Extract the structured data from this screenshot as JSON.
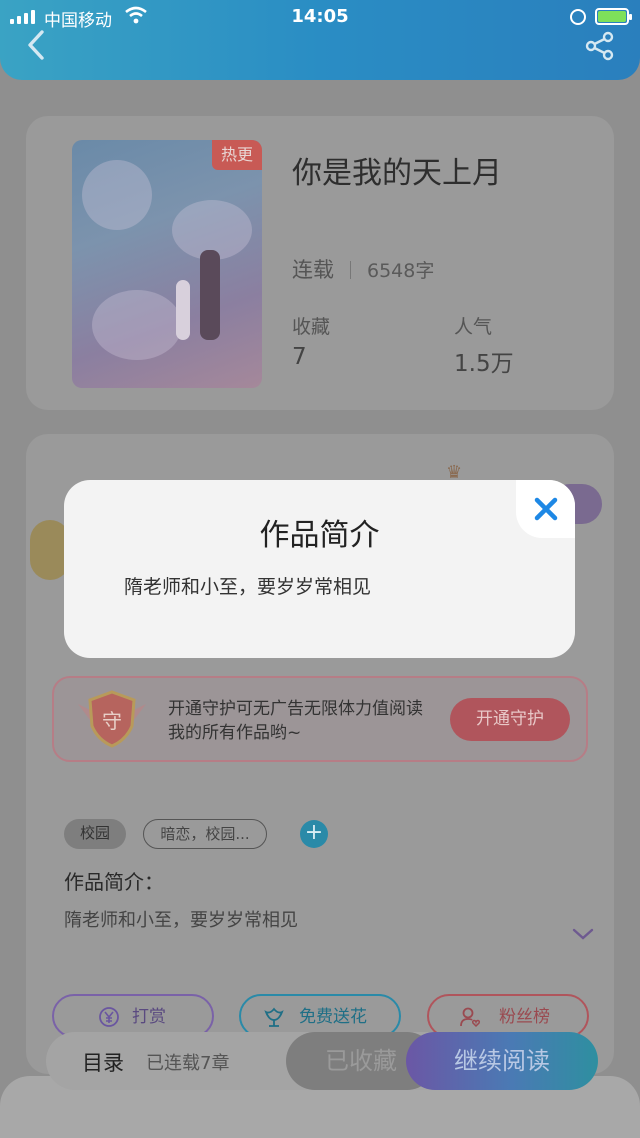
{
  "status_bar": {
    "carrier": "中国移动",
    "time": "14:05"
  },
  "book": {
    "tag": "热更",
    "title": "你是我的天上月",
    "status": "连载",
    "words": "6548字",
    "favorites_label": "收藏",
    "favorites": "7",
    "popularity_label": "人气",
    "popularity": "1.5万"
  },
  "guard": {
    "shield_char": "守",
    "text": "开通守护可无广告无限体力值阅读我的所有作品哟~",
    "button": "开通守护"
  },
  "tags": [
    "校园",
    "暗恋，校园..."
  ],
  "intro": {
    "heading": "作品简介：",
    "text": "隋老师和小至，要岁岁常相见"
  },
  "actions": {
    "reward": "打赏",
    "flower": "免费送花",
    "fans": "粉丝榜"
  },
  "bottom_bar": {
    "directory": "目录",
    "chapters": "已连载7章",
    "favorited": "已收藏",
    "continue": "继续阅读"
  },
  "modal": {
    "title": "作品简介",
    "text": "隋老师和小至，要岁岁常相见"
  },
  "colors": {
    "accent_blue": "#2a8dc4",
    "accent_purple": "#7a62a8",
    "modal_close": "#1e88e5"
  }
}
